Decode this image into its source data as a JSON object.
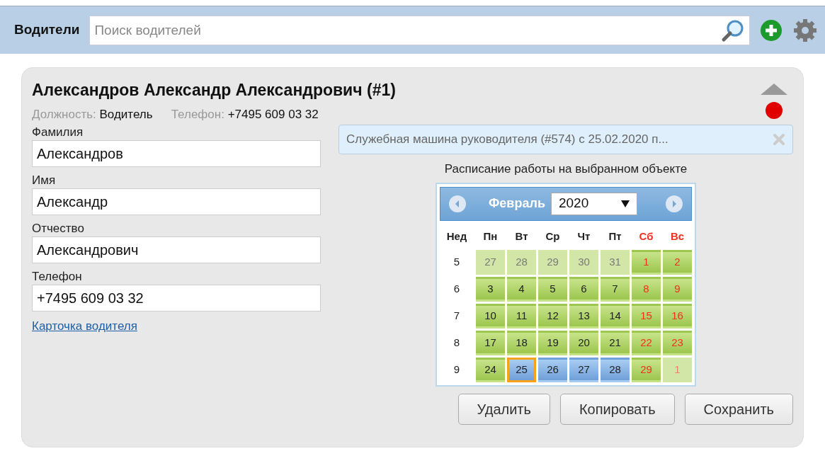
{
  "header": {
    "title": "Водители",
    "search": {
      "placeholder": "Поиск водителей"
    }
  },
  "driver": {
    "title": "Александров Александр Александрович (#1)",
    "position_label": "Должность:",
    "position": "Водитель",
    "phone_label": "Телефон:",
    "phone": "+7495 609 03 32",
    "online": false,
    "fields": [
      {
        "label": "Фамилия",
        "value": "Александров"
      },
      {
        "label": "Имя",
        "value": "Александр"
      },
      {
        "label": "Отчество",
        "value": "Александрович"
      },
      {
        "label": "Телефон",
        "value": "+7495 609 03 32"
      }
    ],
    "card_link": "Карточка водителя"
  },
  "assignment": {
    "text": "Служебная машина руководителя (#574) с 25.02.2020 п..."
  },
  "schedule": {
    "title": "Расписание работы на выбранном объекте",
    "month": "Февраль",
    "year": "2020",
    "weekdays": [
      {
        "label": "Нед",
        "weekend": false
      },
      {
        "label": "Пн",
        "weekend": false
      },
      {
        "label": "Вт",
        "weekend": false
      },
      {
        "label": "Ср",
        "weekend": false
      },
      {
        "label": "Чт",
        "weekend": false
      },
      {
        "label": "Пт",
        "weekend": false
      },
      {
        "label": "Сб",
        "weekend": true
      },
      {
        "label": "Вс",
        "weekend": true
      }
    ],
    "weeks": [
      {
        "number": "5",
        "days": [
          {
            "day": "27",
            "kind": "work",
            "other_month": true,
            "selected": false
          },
          {
            "day": "28",
            "kind": "work",
            "other_month": true,
            "selected": false
          },
          {
            "day": "29",
            "kind": "work",
            "other_month": true,
            "selected": false
          },
          {
            "day": "30",
            "kind": "work",
            "other_month": true,
            "selected": false
          },
          {
            "day": "31",
            "kind": "work",
            "other_month": true,
            "selected": false
          },
          {
            "day": "1",
            "kind": "weekend",
            "other_month": false,
            "selected": false
          },
          {
            "day": "2",
            "kind": "weekend",
            "other_month": false,
            "selected": false
          }
        ]
      },
      {
        "number": "6",
        "days": [
          {
            "day": "3",
            "kind": "work",
            "other_month": false,
            "selected": false
          },
          {
            "day": "4",
            "kind": "work",
            "other_month": false,
            "selected": false
          },
          {
            "day": "5",
            "kind": "work",
            "other_month": false,
            "selected": false
          },
          {
            "day": "6",
            "kind": "work",
            "other_month": false,
            "selected": false
          },
          {
            "day": "7",
            "kind": "work",
            "other_month": false,
            "selected": false
          },
          {
            "day": "8",
            "kind": "weekend",
            "other_month": false,
            "selected": false
          },
          {
            "day": "9",
            "kind": "weekend",
            "other_month": false,
            "selected": false
          }
        ]
      },
      {
        "number": "7",
        "days": [
          {
            "day": "10",
            "kind": "work",
            "other_month": false,
            "selected": false
          },
          {
            "day": "11",
            "kind": "work",
            "other_month": false,
            "selected": false
          },
          {
            "day": "12",
            "kind": "work",
            "other_month": false,
            "selected": false
          },
          {
            "day": "13",
            "kind": "work",
            "other_month": false,
            "selected": false
          },
          {
            "day": "14",
            "kind": "work",
            "other_month": false,
            "selected": false
          },
          {
            "day": "15",
            "kind": "weekend",
            "other_month": false,
            "selected": false
          },
          {
            "day": "16",
            "kind": "weekend",
            "other_month": false,
            "selected": false
          }
        ]
      },
      {
        "number": "8",
        "days": [
          {
            "day": "17",
            "kind": "work",
            "other_month": false,
            "selected": false
          },
          {
            "day": "18",
            "kind": "work",
            "other_month": false,
            "selected": false
          },
          {
            "day": "19",
            "kind": "work",
            "other_month": false,
            "selected": false
          },
          {
            "day": "20",
            "kind": "work",
            "other_month": false,
            "selected": false
          },
          {
            "day": "21",
            "kind": "work",
            "other_month": false,
            "selected": false
          },
          {
            "day": "22",
            "kind": "weekend",
            "other_month": false,
            "selected": false
          },
          {
            "day": "23",
            "kind": "weekend",
            "other_month": false,
            "selected": false
          }
        ]
      },
      {
        "number": "9",
        "days": [
          {
            "day": "24",
            "kind": "work",
            "other_month": false,
            "selected": false
          },
          {
            "day": "25",
            "kind": "assigned",
            "other_month": false,
            "selected": true
          },
          {
            "day": "26",
            "kind": "assigned",
            "other_month": false,
            "selected": false
          },
          {
            "day": "27",
            "kind": "assigned",
            "other_month": false,
            "selected": false
          },
          {
            "day": "28",
            "kind": "assigned",
            "other_month": false,
            "selected": false
          },
          {
            "day": "29",
            "kind": "weekend",
            "other_month": false,
            "selected": false
          },
          {
            "day": "1",
            "kind": "weekend",
            "other_month": true,
            "selected": false
          }
        ]
      }
    ]
  },
  "buttons": [
    "Удалить",
    "Копировать",
    "Сохранить"
  ]
}
